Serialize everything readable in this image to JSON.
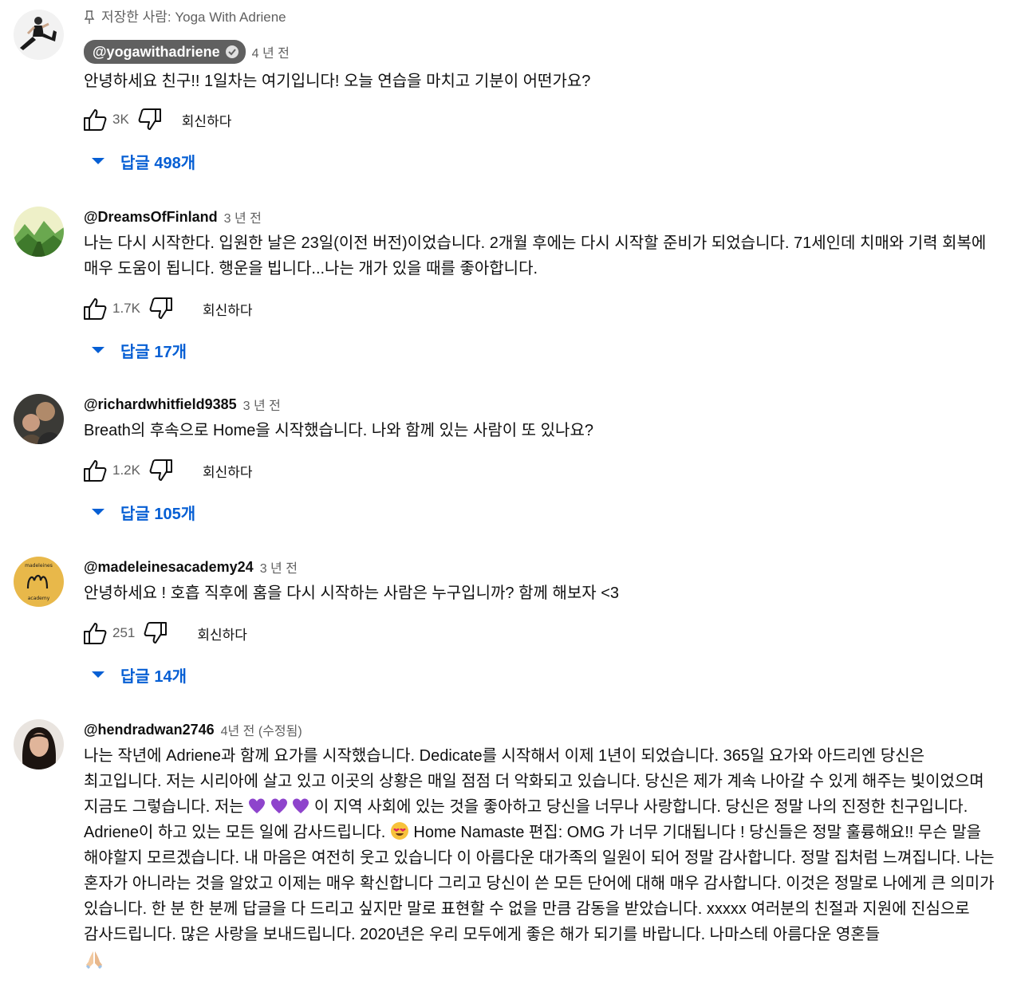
{
  "comments": [
    {
      "pinned_by": "저장한 사람: Yoga With Adriene",
      "author": "@yogawithadriene",
      "time": "4 년 전",
      "text": "안녕하세요 친구!! 1일차는 여기입니다! 오늘 연습을 마치고 기분이 어떤가요?",
      "likes": "3K",
      "reply_label": "회신하다",
      "replies_label": "답글 498개"
    },
    {
      "author": "@DreamsOfFinland",
      "time": "3 년 전",
      "text": "나는 다시 시작한다. 입원한 날은 23일(이전 버전)이었습니다. 2개월 후에는 다시 시작할 준비가 되었습니다. 71세인데 치매와 기력 회복에 매우 도움이 됩니다. 행운을 빕니다...나는 개가 있을 때를 좋아합니다.",
      "likes": "1.7K",
      "reply_label": "회신하다",
      "replies_label": "답글 17개"
    },
    {
      "author": "@richardwhitfield9385",
      "time": "3 년 전",
      "text": "Breath의 후속으로 Home을 시작했습니다. 나와 함께 있는 사람이 또 있나요?",
      "likes": "1.2K",
      "reply_label": "회신하다",
      "replies_label": "답글 105개"
    },
    {
      "author": "@madeleinesacademy24",
      "time": "3 년 전",
      "text": "안녕하세요 ! 호흡 직후에 홈을 다시 시작하는 사람은 누구입니까? 함께 해보자 <3",
      "likes": "251",
      "reply_label": "회신하다",
      "replies_label": "답글 14개",
      "avatar_text": "madeleines academy"
    },
    {
      "author": "@hendradwan2746",
      "time": "4년 전 (수정됨)",
      "text_part1": "나는 작년에 Adriene과 함께 요가를 시작했습니다. Dedicate를 시작해서 이제 1년이 되었습니다. 365일 요가와 아드리엔 당신은 최고입니다. 저는 시리아에 살고 있고 이곳의 상황은 매일 점점 더 악화되고 있습니다. 당신은 제가 계속 나아갈 수 있게 해주는 빛이었으며 지금도 그렇습니다. 저는 ",
      "text_part2": " 이 지역 사회에 있는 것을 좋아하고 당신을 너무나 사랑합니다. 당신은 정말 나의 진정한 친구입니다. Adriene이 하고 있는 모든 일에 감사드립니다. ",
      "text_part3": "Home Namaste 편집: OMG 가 너무 기대됩니다 ! 당신들은 정말 훌륭해요!! 무슨 말을 해야할지 모르겠습니다. 내 마음은 여전히 웃고 있습니다   이 아름다운 대가족의 일원이 되어 정말 감사합니다. 정말 집처럼 느껴집니다. 나는 혼자가 아니라는 것을 알았고 이제는 매우 확신합니다   그리고 당신이 쓴 모든 단어에 대해 매우 감사합니다. 이것은 정말로 나에게 큰 의미가 있습니다. 한 분 한 분께 답글을 다 드리고 싶지만 말로 표현할 수 없을 만큼 감동을 받았습니다. xxxxx 여러분의 친절과 지원에 진심으로 감사드립니다. 많은 사랑을 보내드립니다. 2020년은 우리 모두에게 좋은 해가 되기를 바랍니다. 나마스테 아름다운 영혼들"
    }
  ],
  "colors": {
    "link": "#065fd4",
    "muted": "#606060",
    "heart": "#8e44cc"
  },
  "icons": [
    "pin-icon",
    "verified-icon",
    "like-icon",
    "dislike-icon",
    "caret-down-icon",
    "purple-heart-emoji",
    "heart-eyes-emoji",
    "folded-hands-emoji"
  ]
}
